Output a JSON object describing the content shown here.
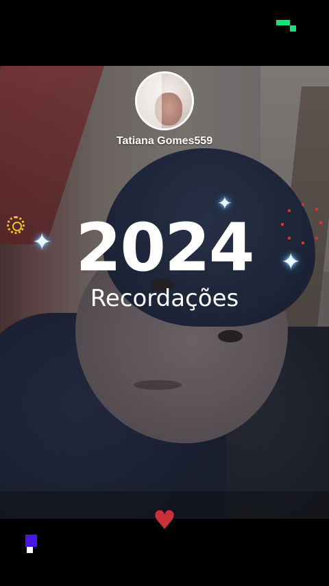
{
  "profile": {
    "username": "Tatiana Gomes559"
  },
  "title": {
    "year": "2024",
    "subtitle": "Recordações"
  },
  "icons": {
    "brand": "brand-logo-icon",
    "sparkle": "sparkle-icon",
    "sun": "sun-icon",
    "heart": "heart-icon",
    "corner": "corner-badge-icon"
  },
  "colors": {
    "accent_green": "#19e07a",
    "heart_red": "#c8313a",
    "sparkle_blue": "#8fd0ff",
    "corner_purple": "#4a16e6",
    "sun_yellow": "#f4c22a"
  }
}
